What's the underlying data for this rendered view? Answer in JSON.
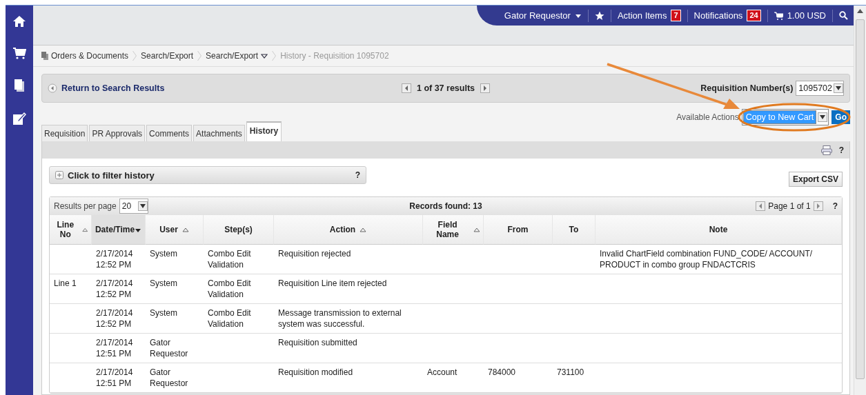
{
  "top_nav": {
    "user_menu": "Gator Requestor",
    "action_items": {
      "label": "Action Items",
      "count": "7"
    },
    "notifications": {
      "label": "Notifications",
      "count": "24"
    },
    "cart": "1.00 USD"
  },
  "breadcrumbs": [
    {
      "label": "Orders & Documents",
      "kind": "root"
    },
    {
      "label": "Search/Export",
      "kind": "link"
    },
    {
      "label": "Search/Export",
      "kind": "dropdown"
    },
    {
      "label": "History - Requisition 1095702",
      "kind": "current"
    }
  ],
  "result_nav": {
    "back_link": "Return to Search Results",
    "position": "1 of 37 results",
    "number_label": "Requisition Number(s)",
    "number_value": "1095702"
  },
  "actions": {
    "label": "Available Actions",
    "value": "Copy to New Cart",
    "button": "Go"
  },
  "tabs": [
    {
      "label": "Requisition",
      "selected": false
    },
    {
      "label": "PR Approvals",
      "selected": false
    },
    {
      "label": "Comments",
      "selected": false
    },
    {
      "label": "Attachments",
      "selected": false
    },
    {
      "label": "History",
      "selected": true
    }
  ],
  "section_help": "?",
  "filter": {
    "label": "Click to filter history",
    "help": "?"
  },
  "export_button": "Export CSV",
  "table": {
    "results_per_page_label": "Results per page",
    "results_per_page": "20",
    "records": "Records found: 13",
    "pager": "Page 1 of 1",
    "help": "?",
    "columns": [
      {
        "label": "Line No",
        "sortable": true,
        "sorted": false
      },
      {
        "label": "Date/Time",
        "sortable": true,
        "sorted": true
      },
      {
        "label": "User",
        "sortable": true,
        "sorted": false
      },
      {
        "label": "Step(s)",
        "sortable": false,
        "sorted": false
      },
      {
        "label": "Action",
        "sortable": true,
        "sorted": false
      },
      {
        "label": "Field Name",
        "sortable": true,
        "sorted": false
      },
      {
        "label": "From",
        "sortable": false,
        "sorted": false
      },
      {
        "label": "To",
        "sortable": false,
        "sorted": false
      },
      {
        "label": "Note",
        "sortable": false,
        "sorted": false
      }
    ],
    "rows": [
      [
        "",
        "2/17/2014 12:52 PM",
        "System",
        "Combo Edit Validation",
        "Requisition rejected",
        "",
        "",
        "",
        "Invalid ChartField combination FUND_CODE/ ACCOUNT/ PRODUCT in combo group FNDACTCRIS"
      ],
      [
        "Line 1",
        "2/17/2014 12:52 PM",
        "System",
        "Combo Edit Validation",
        "Requisition Line item rejected",
        "",
        "",
        "",
        ""
      ],
      [
        "",
        "2/17/2014 12:52 PM",
        "System",
        "Combo Edit Validation",
        "Message transmission to external system was successful.",
        "",
        "",
        "",
        ""
      ],
      [
        "",
        "2/17/2014 12:51 PM",
        "Gator Requestor",
        "",
        "Requisition submitted",
        "",
        "",
        "",
        ""
      ],
      [
        "",
        "2/17/2014 12:51 PM",
        "Gator Requestor",
        "",
        "Requisition modified",
        "Account",
        "784000",
        "731100",
        ""
      ]
    ]
  }
}
